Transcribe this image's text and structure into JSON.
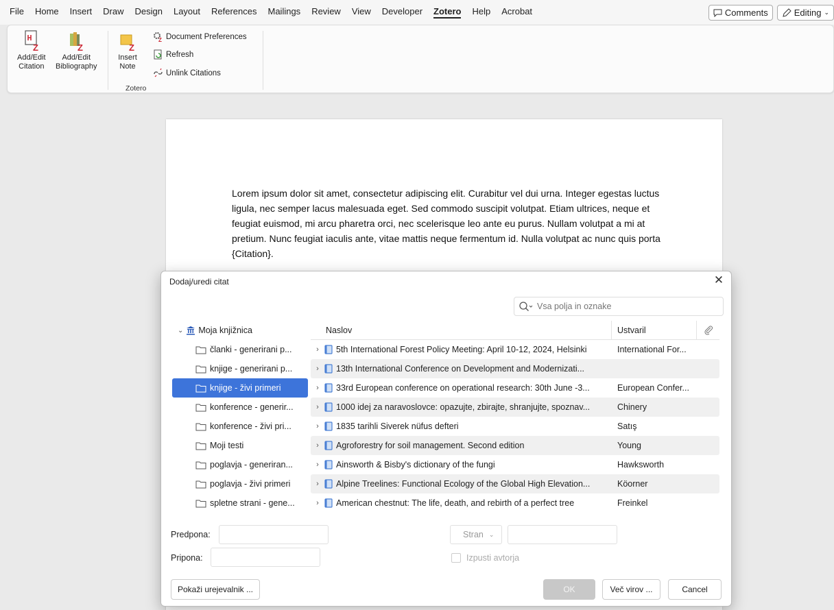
{
  "menu": {
    "tabs": [
      "File",
      "Home",
      "Insert",
      "Draw",
      "Design",
      "Layout",
      "References",
      "Mailings",
      "Review",
      "View",
      "Developer",
      "Zotero",
      "Help",
      "Acrobat"
    ],
    "active_tab": "Zotero",
    "comments_label": "Comments",
    "editing_label": "Editing"
  },
  "ribbon": {
    "add_edit_citation": [
      "Add/Edit",
      "Citation"
    ],
    "add_edit_bibliography": [
      "Add/Edit",
      "Bibliography"
    ],
    "insert_note": [
      "Insert",
      "Note"
    ],
    "document_preferences": "Document Preferences",
    "refresh": "Refresh",
    "unlink_citations": "Unlink Citations",
    "group_label": "Zotero"
  },
  "document": {
    "paragraph": "Lorem ipsum dolor sit amet, consectetur adipiscing elit. Curabitur vel dui urna. Integer egestas luctus ligula, nec semper lacus malesuada eget. Sed commodo suscipit volutpat. Etiam ultrices, neque et feugiat euismod, mi arcu pharetra orci, nec scelerisque leo ante eu purus. Nullam volutpat a mi at pretium. Nunc feugiat iaculis ante, vitae mattis neque fermentum id. Nulla volutpat ac nunc quis porta {Citation}."
  },
  "dialog": {
    "title": "Dodaj/uredi citat",
    "search_placeholder": "Vsa polja in oznake",
    "library_root": "Moja knjižnica",
    "collections": [
      "članki - generirani p...",
      "knjige - generirani p...",
      "knjige - živi primeri",
      "konference - generir...",
      "konference - živi pri...",
      "Moji testi",
      "poglavja - generiran...",
      "poglavja - živi primeri",
      "spletne strani - gene..."
    ],
    "selected_collection_index": 2,
    "columns": {
      "title": "Naslov",
      "creator": "Ustvaril"
    },
    "items": [
      {
        "title": "5th International Forest Policy Meeting: April 10-12, 2024, Helsinki",
        "creator": "International For..."
      },
      {
        "title": "13th International Conference on Development and Modernizati...",
        "creator": ""
      },
      {
        "title": "33rd European conference on operational research: 30th June -3...",
        "creator": "European Confer..."
      },
      {
        "title": "1000 idej za naravoslovce: opazujte, zbirajte, shranjujte, spoznav...",
        "creator": "Chinery"
      },
      {
        "title": "1835 tarihli Siverek nüfus defteri",
        "creator": "Satış"
      },
      {
        "title": "Agroforestry for soil management. Second edition",
        "creator": "Young"
      },
      {
        "title": "Ainsworth & Bisby's dictionary of the fungi",
        "creator": "Hawksworth"
      },
      {
        "title": "Alpine Treelines: Functional Ecology of the Global High Elevation...",
        "creator": "Köorner"
      },
      {
        "title": "American chestnut: The life, death, and rebirth of a perfect tree",
        "creator": "Freinkel"
      }
    ],
    "prefix_label": "Predpona:",
    "suffix_label": "Pripona:",
    "locator_label": "Stran",
    "omit_author_label": "Izpusti avtorja",
    "show_editor_label": "Pokaži urejevalnik ...",
    "ok_label": "OK",
    "multiple_sources_label": "Več virov ...",
    "cancel_label": "Cancel"
  },
  "colors": {
    "selected": "#3d74da",
    "zotero_red": "#cc2936",
    "book_blue": "#4a7fd4"
  }
}
